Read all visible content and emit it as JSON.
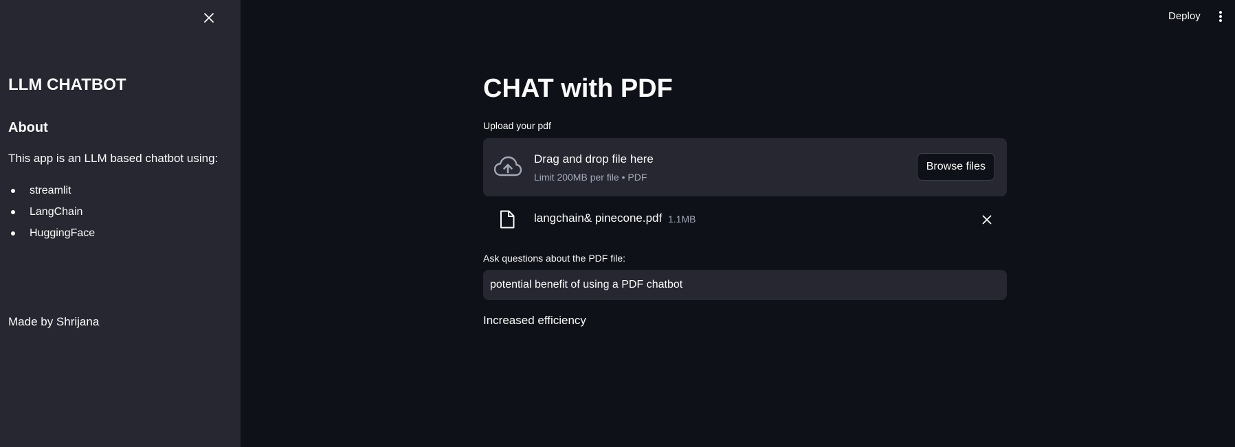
{
  "sidebar": {
    "close_icon": "close-icon",
    "title": "LLM CHATBOT",
    "about_heading": "About",
    "description": "This app is an LLM based chatbot using:",
    "items": [
      {
        "label": "streamlit"
      },
      {
        "label": "LangChain"
      },
      {
        "label": "HuggingFace"
      }
    ],
    "footer": "Made by Shrijana"
  },
  "header": {
    "deploy_label": "Deploy",
    "menu_icon": "vertical-dots-icon"
  },
  "main": {
    "title": "CHAT with PDF",
    "upload": {
      "label": "Upload your pdf",
      "drop_text": "Drag and drop file here",
      "limit_text": "Limit 200MB per file • PDF",
      "browse_label": "Browse files",
      "icon": "cloud-upload-icon"
    },
    "file": {
      "name": "langchain& pinecone.pdf",
      "size": "1.1MB",
      "icon": "file-icon",
      "remove_icon": "close-icon"
    },
    "question": {
      "label": "Ask questions about the PDF file:",
      "value": "potential benefit of using a PDF chatbot"
    },
    "answer": "Increased efficiency"
  },
  "colors": {
    "background": "#0e1117",
    "sidebar": "#262730",
    "text": "#fafafa",
    "muted": "#a3a8b8"
  }
}
